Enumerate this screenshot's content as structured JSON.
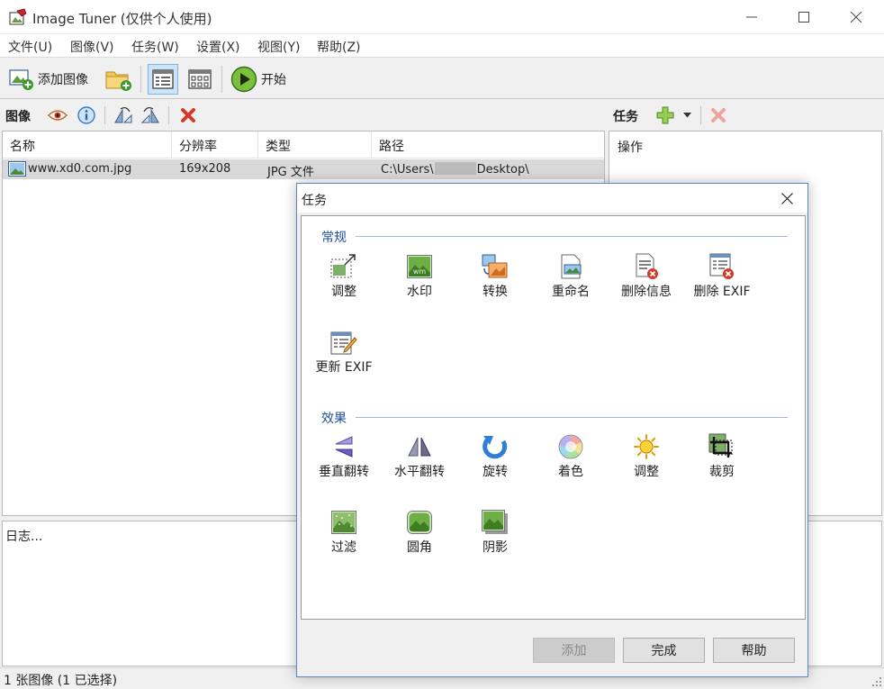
{
  "window": {
    "title": "Image Tuner (仅供个人使用)"
  },
  "menu": [
    "文件(U)",
    "图像(V)",
    "任务(W)",
    "设置(X)",
    "视图(Y)",
    "帮助(Z)"
  ],
  "toolbar": {
    "add_image_label": "添加图像",
    "start_label": "开始"
  },
  "images_panel": {
    "title": "图像",
    "columns": [
      "名称",
      "分辨率",
      "类型",
      "路径"
    ],
    "rows": [
      {
        "name": "www.xd0.com.jpg",
        "resolution": "169x208",
        "type": "JPG 文件",
        "path_start": "C:\\Users\\",
        "path_end": "Desktop\\"
      }
    ]
  },
  "tasks_panel": {
    "title": "任务",
    "column": "操作"
  },
  "log": {
    "text": "日志..."
  },
  "status": {
    "text": "1 张图像 (1 已选择)"
  },
  "dialog": {
    "title": "任务",
    "groups": [
      {
        "title": "常规",
        "tools": [
          {
            "label": "调整",
            "icon": "resize-icon"
          },
          {
            "label": "水印",
            "icon": "watermark-icon"
          },
          {
            "label": "转换",
            "icon": "convert-icon"
          },
          {
            "label": "重命名",
            "icon": "rename-icon"
          },
          {
            "label": "删除信息",
            "icon": "delete-info-icon"
          },
          {
            "label": "删除 EXIF",
            "icon": "delete-exif-icon"
          },
          {
            "label": "更新 EXIF",
            "icon": "update-exif-icon"
          }
        ]
      },
      {
        "title": "效果",
        "tools": [
          {
            "label": "垂直翻转",
            "icon": "flip-vertical-icon"
          },
          {
            "label": "水平翻转",
            "icon": "flip-horizontal-icon"
          },
          {
            "label": "旋转",
            "icon": "rotate-icon"
          },
          {
            "label": "着色",
            "icon": "colorize-icon"
          },
          {
            "label": "调整",
            "icon": "brightness-icon"
          },
          {
            "label": "裁剪",
            "icon": "crop-icon"
          },
          {
            "label": "过滤",
            "icon": "filter-icon"
          },
          {
            "label": "圆角",
            "icon": "round-corners-icon"
          },
          {
            "label": "阴影",
            "icon": "shadow-icon"
          }
        ]
      }
    ],
    "buttons": {
      "add": "添加",
      "done": "完成",
      "help": "帮助"
    }
  },
  "colors": {
    "accent": "#1e4fa0",
    "selection": "#d9d9d9",
    "dialog_border": "#5b86c5"
  }
}
